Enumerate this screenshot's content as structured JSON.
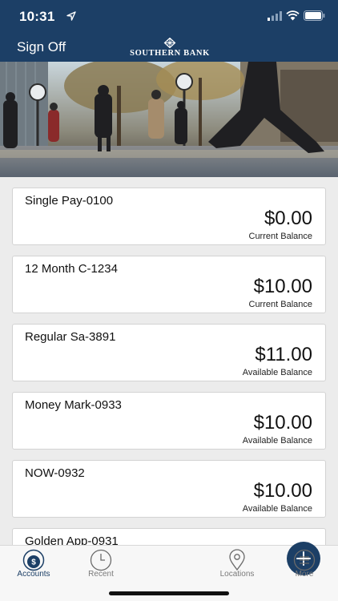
{
  "status_bar": {
    "time": "10:31"
  },
  "header": {
    "sign_off": "Sign Off",
    "logo_text": "SOUTHERN BANK"
  },
  "accounts": [
    {
      "name": "Single Pay-0100",
      "balance": "$0.00",
      "label": "Current Balance"
    },
    {
      "name": "12 Month C-1234",
      "balance": "$10.00",
      "label": "Current Balance"
    },
    {
      "name": "Regular Sa-3891",
      "balance": "$11.00",
      "label": "Available Balance"
    },
    {
      "name": "Money Mark-0933",
      "balance": "$10.00",
      "label": "Available Balance"
    },
    {
      "name": "NOW-0932",
      "balance": "$10.00",
      "label": "Available Balance"
    },
    {
      "name": "Golden App-0931",
      "balance": "",
      "label": ""
    }
  ],
  "tabs": {
    "accounts": "Accounts",
    "recent": "Recent",
    "add": "add-icon",
    "locations": "Locations",
    "more": "More"
  },
  "colors": {
    "brand": "#1c3f66",
    "background": "#ececec"
  }
}
